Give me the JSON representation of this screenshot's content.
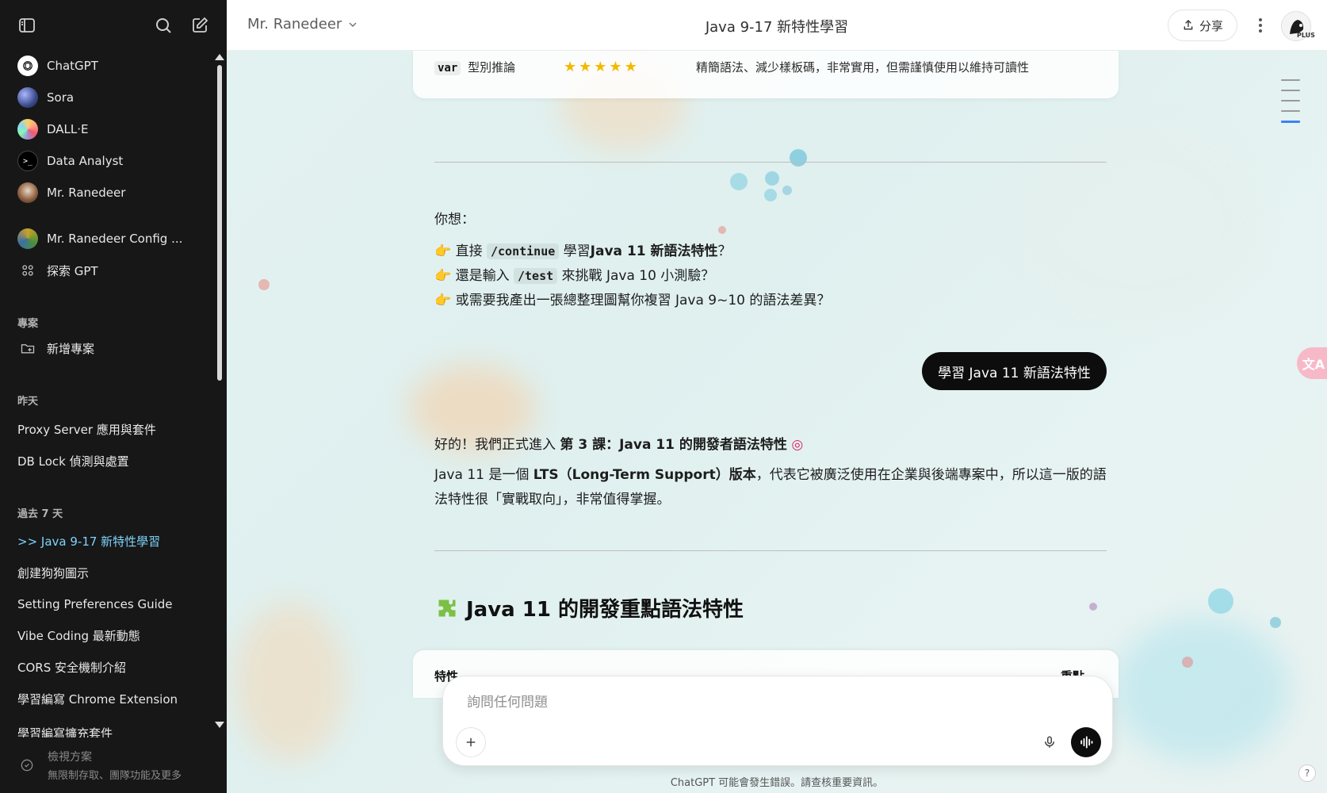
{
  "sidebar": {
    "gpts": [
      {
        "label": "ChatGPT",
        "icon": "chatgpt-logo-icon"
      },
      {
        "label": "Sora",
        "icon": "sora-logo-icon"
      },
      {
        "label": "DALL·E",
        "icon": "dalle-logo-icon"
      },
      {
        "label": "Data Analyst",
        "icon": "data-analyst-icon"
      },
      {
        "label": "Mr. Ranedeer",
        "icon": "mr-ranedeer-avatar"
      },
      {
        "label": "Mr. Ranedeer Config ...",
        "icon": "mr-ranedeer-config-avatar"
      },
      {
        "label": "探索 GPT",
        "icon": "explore-grid-icon"
      }
    ],
    "projects_header": "專案",
    "new_project": "新增專案",
    "yesterday_header": "昨天",
    "yesterday": [
      "Proxy Server 應用與套件",
      "DB Lock 偵測與處置"
    ],
    "week_header": "過去 7 天",
    "week": [
      ">>  Java 9-17 新特性學習",
      "創建狗狗圖示",
      "Setting Preferences Guide",
      "Vibe Coding 最新動態",
      "CORS 安全機制介紹",
      "學習編寫 Chrome Extension",
      "學習編寫擴充套件"
    ],
    "plan_title": "檢視方案",
    "plan_sub": "無限制存取、團隊功能及更多"
  },
  "topbar": {
    "model": "Mr. Ranedeer",
    "title": "Java 9-17 新特性學習",
    "share": "分享",
    "plus": "PLUS"
  },
  "content": {
    "top_row": {
      "code": "var",
      "feature": "型別推論",
      "stars": 5,
      "note": "精簡語法、減少樣板碼，非常實用，但需謹慎使用以維持可讀性"
    },
    "you_want": "你想：",
    "opt1_pre": "直接",
    "opt1_code": "/continue",
    "opt1_mid": "學習",
    "opt1_bold": "Java 11 新語法特性",
    "opt1_end": "？",
    "opt2_pre": "還是輸入",
    "opt2_code": "/test",
    "opt2_end": "來挑戰 Java 10 小測驗？",
    "opt3": "或需要我產出一張總整理圖幫你複習 Java 9~10 的語法差異？",
    "user_msg": "學習 Java 11 新語法特性",
    "resp_pre": "好的！我們正式進入",
    "resp_bold": "第 3 課：Java 11 的開發者語法特性",
    "resp2_pre": "Java 11 是一個",
    "resp2_bold": "LTS（Long-Term Support）版本",
    "resp2_rest": "，代表它被廣泛使用在企業與後端專案中，所以這一版的語",
    "resp3": "法特性很「實戰取向」，非常值得掌握。",
    "heading": "Java 11 的開發重點語法特性",
    "th1": "特性",
    "th2": "重點"
  },
  "composer": {
    "placeholder": "詢問任何問題"
  },
  "footer": "ChatGPT 可能會發生錯誤。請查核重要資訊。",
  "help": "?",
  "translate": "文A"
}
